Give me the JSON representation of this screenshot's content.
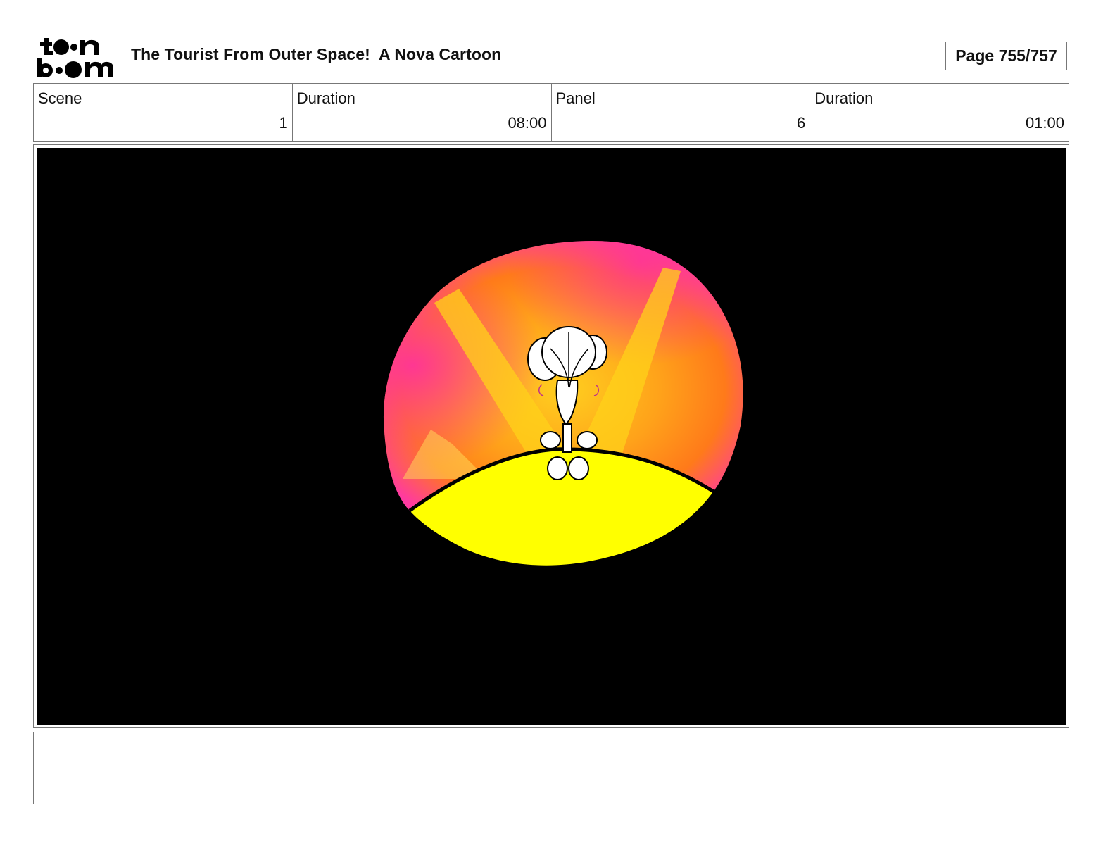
{
  "header": {
    "logo": {
      "brand": "toon boom",
      "line1": "toon",
      "line2": "boom"
    },
    "title": "The Tourist From Outer Space!  A Nova Cartoon",
    "page": "Page 755/757"
  },
  "info": [
    {
      "label": "Scene",
      "value": "1"
    },
    {
      "label": "Duration",
      "value": "08:00"
    },
    {
      "label": "Panel",
      "value": "6"
    },
    {
      "label": "Duration",
      "value": "01:00"
    }
  ],
  "panel": {
    "description_icon": "character-in-spotlight-illustration",
    "colors": {
      "background": "#000000",
      "stage": "#ffff00",
      "glow_orange": "#ff8c1a",
      "glow_pink": "#ff2fa0",
      "beam": "#ffd21a"
    }
  },
  "notes": {
    "text": ""
  }
}
